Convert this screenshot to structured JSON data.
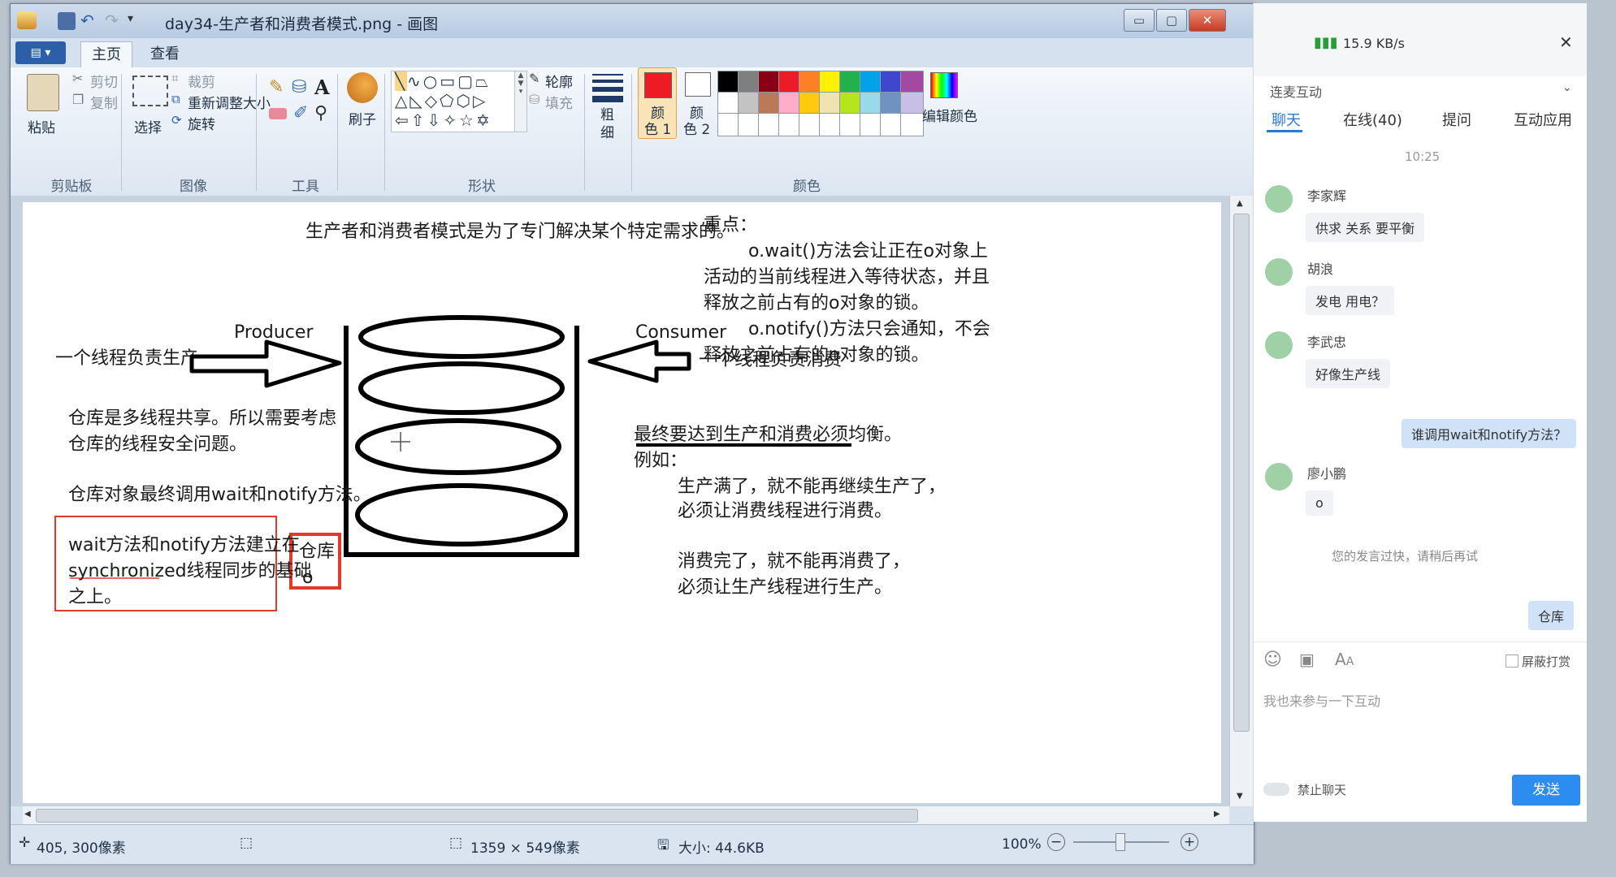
{
  "window": {
    "title": "day34-生产者和消费者模式.png - 画图",
    "buttons": {
      "minimize": "▭",
      "maximize": "▢",
      "close": "✕"
    }
  },
  "ribbon": {
    "tabs": [
      "主页",
      "查看"
    ],
    "clipboard": {
      "paste": "粘贴",
      "cut": "剪切",
      "copy": "复制",
      "group": "剪贴板"
    },
    "image": {
      "select": "选择",
      "crop": "裁剪",
      "resize": "重新调整大小",
      "rotate": "旋转",
      "group": "图像"
    },
    "tools": {
      "group": "工具"
    },
    "brush": {
      "label": "刷子"
    },
    "shapes": {
      "outline": "轮廓",
      "fill": "填充",
      "group": "形状"
    },
    "size": {
      "label1": "粗",
      "label2": "细"
    },
    "color1": {
      "l1": "颜",
      "l2": "色 1"
    },
    "color2": {
      "l1": "颜",
      "l2": "色 2"
    },
    "colors_group": "颜色",
    "edit_colors": "编辑颜色",
    "palette_row1": [
      "#000000",
      "#7f7f7f",
      "#880015",
      "#ed1c24",
      "#ff7f27",
      "#fff200",
      "#22b14c",
      "#00a2e8",
      "#3f48cc",
      "#a349a4"
    ],
    "palette_row2": [
      "#ffffff",
      "#c3c3c3",
      "#b97a57",
      "#ffaec9",
      "#ffc90e",
      "#efe4b0",
      "#b5e61d",
      "#99d9ea",
      "#7092be",
      "#c8bfe7"
    ],
    "color1_value": "#ed1c24",
    "color2_value": "#ffffff"
  },
  "canvas": {
    "heading": "生产者和消费者模式是为了专门解决某个特定需求的。",
    "key_title": "重点：",
    "key_lines": [
      "o.wait()方法会让正在o对象上",
      "活动的当前线程进入等待状态，并且",
      "释放之前占有的o对象的锁。",
      "o.notify()方法只会通知，不会",
      "释放之前占有的o对象的锁。"
    ],
    "producer": "Producer",
    "consumer": "Consumer",
    "producer_desc": "一个线程负责生产",
    "consumer_desc": "一个线程负责消费",
    "warehouse_lines": [
      "仓库是多线程共享。所以需要考虑",
      "仓库的线程安全问题。"
    ],
    "warehouse_call": "仓库对象最终调用wait和notify方法。",
    "red_box_lines": [
      "wait方法和notify方法建立在",
      "synchronized线程同步的基础",
      "之上。"
    ],
    "small_box": [
      "仓库",
      "o"
    ],
    "balance": "最终要达到生产和消费必须均衡。",
    "example": "例如：",
    "example_lines": [
      "生产满了，就不能再继续生产了，",
      "必须让消费线程进行消费。",
      "",
      "消费完了，就不能再消费了，",
      "必须让生产线程进行生产。"
    ]
  },
  "status": {
    "cursor": "405, 300像素",
    "dims": "1359 × 549像素",
    "size": "大小: 44.6KB",
    "zoom": "100%"
  },
  "chat": {
    "speed": "15.9 KB/s",
    "section": "连麦互动",
    "tabs": [
      "聊天",
      "在线(40)",
      "提问",
      "互动应用"
    ],
    "time": "10:25",
    "messages": [
      {
        "name": "李家辉",
        "text": "供求 关系 要平衡"
      },
      {
        "name": "胡浪",
        "text": "发电 用电？"
      },
      {
        "name": "李武忠",
        "text": "好像生产线"
      }
    ],
    "self_msg1": "谁调用wait和notify方法？",
    "msg4": {
      "name": "廖小鹏",
      "text": "o"
    },
    "notice": "您的发言过快，请稍后再试",
    "self_msg2": "仓库",
    "block_reward": "屏蔽打赏",
    "input_placeholder": "我也来参与一下互动",
    "mute": "禁止聊天",
    "send": "发送"
  }
}
